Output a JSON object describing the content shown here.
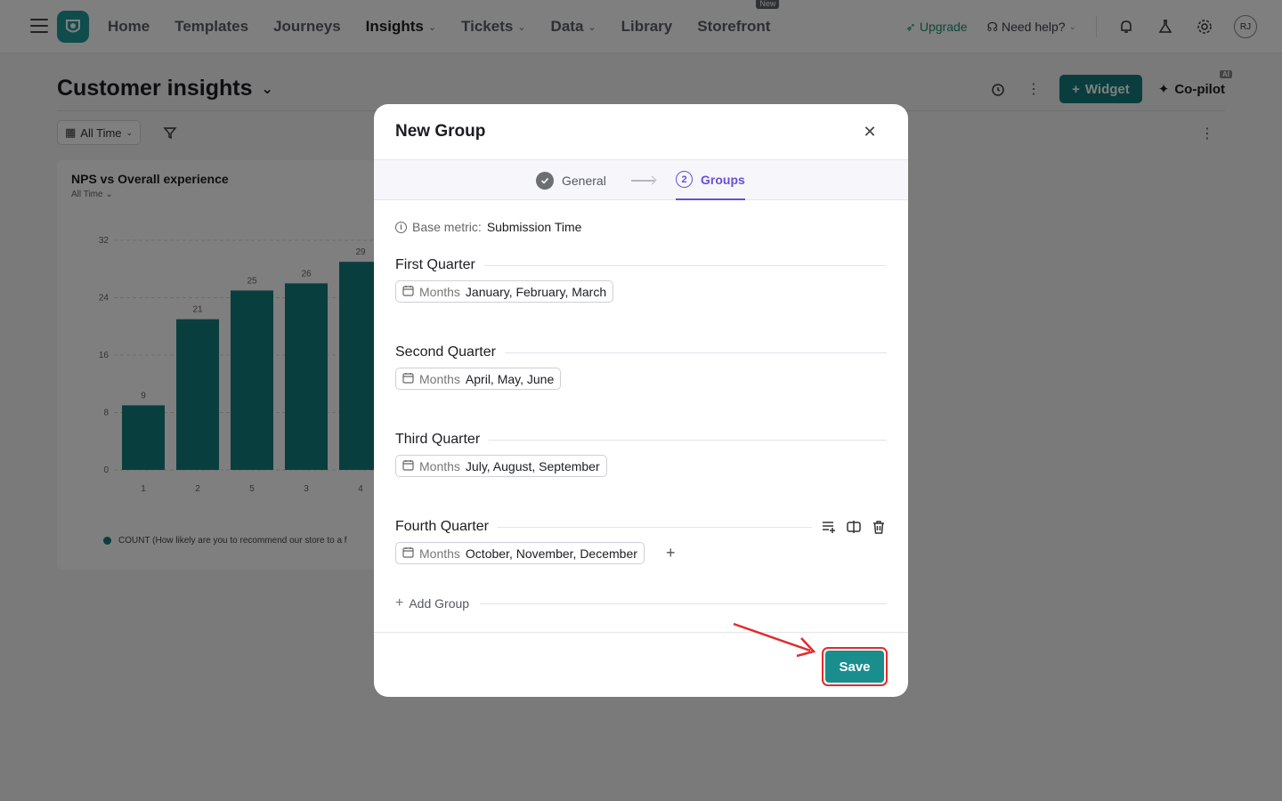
{
  "nav": {
    "items": [
      {
        "label": "Home",
        "chevron": false,
        "active": false
      },
      {
        "label": "Templates",
        "chevron": false,
        "active": false
      },
      {
        "label": "Journeys",
        "chevron": false,
        "active": false
      },
      {
        "label": "Insights",
        "chevron": true,
        "active": true
      },
      {
        "label": "Tickets",
        "chevron": true,
        "active": false
      },
      {
        "label": "Data",
        "chevron": true,
        "active": false
      },
      {
        "label": "Library",
        "chevron": false,
        "active": false
      },
      {
        "label": "Storefront",
        "chevron": false,
        "active": false,
        "badge": "New"
      }
    ],
    "upgrade": "Upgrade",
    "help": "Need help?",
    "avatar": "RJ"
  },
  "page": {
    "title": "Customer insights",
    "widget_button": "Widget",
    "copilot": "Co-pilot",
    "copilot_badge": "AI",
    "time_filter": "All Time"
  },
  "chart_card": {
    "title": "NPS vs Overall experience",
    "subtitle": "All Time",
    "legend": "COUNT (How likely are you to recommend our store to a f"
  },
  "chart_data": {
    "type": "bar",
    "title": "NPS vs Overall experience",
    "categories": [
      "1",
      "2",
      "5",
      "3",
      "4"
    ],
    "series": [
      {
        "name": "COUNT (How likely are you to recommend our store to a f",
        "values": [
          9,
          21,
          25,
          26,
          29
        ]
      }
    ],
    "yticks": [
      0,
      8,
      16,
      24,
      32
    ],
    "ylim": [
      0,
      32
    ],
    "grid": true,
    "color": "#127c7c"
  },
  "modal": {
    "title": "New Group",
    "steps": {
      "general": "General",
      "groups": "Groups",
      "groups_num": "2"
    },
    "base_metric_label": "Base metric:",
    "base_metric_value": "Submission Time",
    "groups": [
      {
        "name": "First Quarter",
        "chip_label": "Months",
        "chip_value": "January, February, March"
      },
      {
        "name": "Second Quarter",
        "chip_label": "Months",
        "chip_value": "April, May, June"
      },
      {
        "name": "Third Quarter",
        "chip_label": "Months",
        "chip_value": "July, August, September"
      },
      {
        "name": "Fourth Quarter",
        "chip_label": "Months",
        "chip_value": "October, November, December"
      }
    ],
    "add_group": "Add Group",
    "save": "Save"
  },
  "colors": {
    "accent": "#1a8d8d",
    "step_active": "#6a4fd1",
    "highlight": "#e22b2b"
  }
}
